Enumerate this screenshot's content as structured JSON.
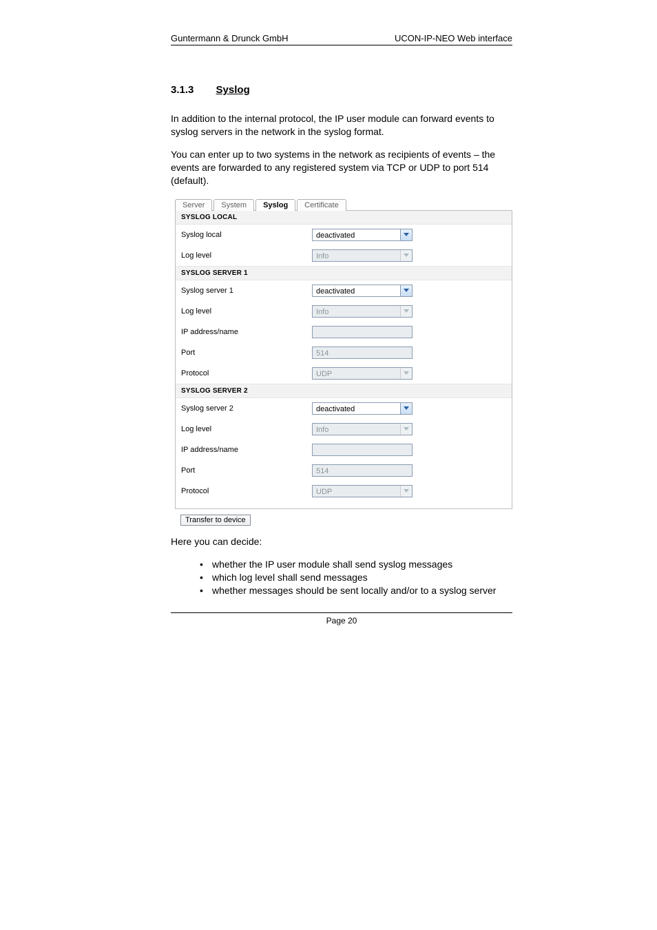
{
  "header": {
    "left": "Guntermann & Drunck GmbH",
    "right": "UCON-IP-NEO Web interface"
  },
  "section": {
    "number": "3.1.3",
    "title": "Syslog"
  },
  "body": {
    "p1": "In addition to the internal protocol, the IP user module can forward events to syslog servers in the network in the syslog format.",
    "p2": "You can enter up to two systems in the network as recipients of events – the events are forwarded to any registered system via TCP or UDP to port 514 (default)."
  },
  "ui": {
    "tabs": {
      "server": "Server",
      "system": "System",
      "syslog": "Syslog",
      "certificate": "Certificate"
    },
    "sections": {
      "local": {
        "title": "SYSLOG LOCAL",
        "rows": {
          "syslog_local": {
            "label": "Syslog local",
            "value": "deactivated"
          },
          "log_level": {
            "label": "Log level",
            "value": "Info"
          }
        }
      },
      "server1": {
        "title": "SYSLOG SERVER 1",
        "rows": {
          "syslog_server": {
            "label": "Syslog server 1",
            "value": "deactivated"
          },
          "log_level": {
            "label": "Log level",
            "value": "Info"
          },
          "ip": {
            "label": "IP address/name",
            "value": ""
          },
          "port": {
            "label": "Port",
            "value": "514"
          },
          "protocol": {
            "label": "Protocol",
            "value": "UDP"
          }
        }
      },
      "server2": {
        "title": "SYSLOG SERVER 2",
        "rows": {
          "syslog_server": {
            "label": "Syslog server 2",
            "value": "deactivated"
          },
          "log_level": {
            "label": "Log level",
            "value": "Info"
          },
          "ip": {
            "label": "IP address/name",
            "value": ""
          },
          "port": {
            "label": "Port",
            "value": "514"
          },
          "protocol": {
            "label": "Protocol",
            "value": "UDP"
          }
        }
      }
    },
    "transfer_btn": "Transfer to device"
  },
  "after": {
    "intro": "Here you can decide:",
    "bullets": [
      "whether the IP user module shall send syslog messages",
      "which log level shall send messages",
      "whether messages should be sent locally and/or to a syslog server"
    ]
  },
  "footer": {
    "page": "Page 20"
  }
}
